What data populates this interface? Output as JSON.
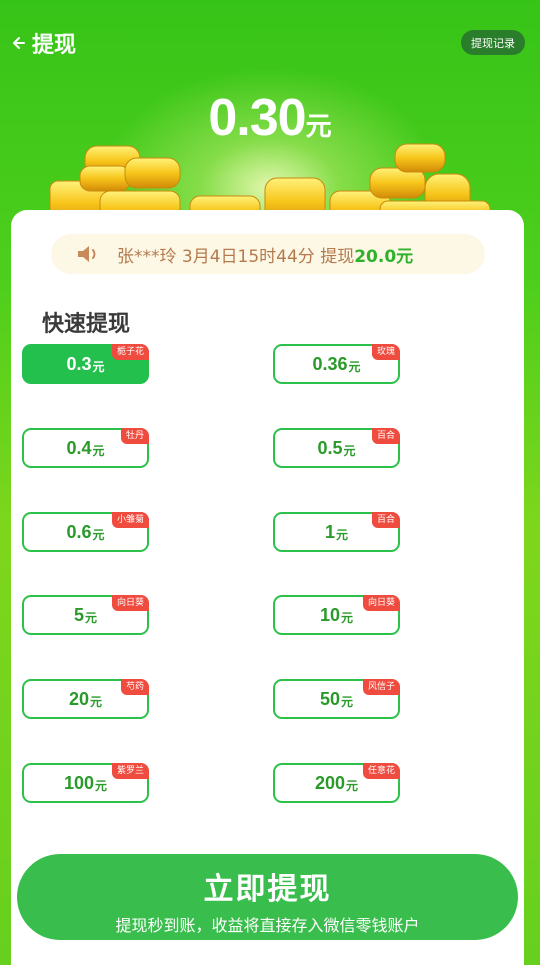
{
  "header": {
    "back_label": "提现",
    "record_label": "提现记录"
  },
  "balance": {
    "amount": "0.30",
    "unit": "元"
  },
  "notice": {
    "text": "张***玲 3月4日15时44分 提现",
    "amount": "20.0元"
  },
  "section_title": "快速提现",
  "options": [
    {
      "value": "0.3",
      "unit": "元",
      "tag": "栀子花",
      "selected": true
    },
    {
      "value": "0.36",
      "unit": "元",
      "tag": "玫瑰",
      "selected": false
    },
    {
      "value": "0.4",
      "unit": "元",
      "tag": "牡丹",
      "selected": false
    },
    {
      "value": "0.5",
      "unit": "元",
      "tag": "百合",
      "selected": false
    },
    {
      "value": "0.6",
      "unit": "元",
      "tag": "小雏菊",
      "selected": false
    },
    {
      "value": "1",
      "unit": "元",
      "tag": "百合",
      "selected": false
    },
    {
      "value": "5",
      "unit": "元",
      "tag": "向日葵",
      "selected": false
    },
    {
      "value": "10",
      "unit": "元",
      "tag": "向日葵",
      "selected": false
    },
    {
      "value": "20",
      "unit": "元",
      "tag": "芍药",
      "selected": false
    },
    {
      "value": "50",
      "unit": "元",
      "tag": "风信子",
      "selected": false
    },
    {
      "value": "100",
      "unit": "元",
      "tag": "紫罗兰",
      "selected": false
    },
    {
      "value": "200",
      "unit": "元",
      "tag": "任意花",
      "selected": false
    }
  ],
  "cta": {
    "label": "立即提现",
    "sub": "提现秒到账，收益将直接存入微信零钱账户"
  },
  "colors": {
    "brand_green": "#2fb52b",
    "selected_green": "#23c04d",
    "tag_red": "#ef4b3f",
    "notice_text": "#b47a4c"
  },
  "icons": {
    "back": "arrow-left-icon",
    "speaker": "speaker-icon"
  }
}
